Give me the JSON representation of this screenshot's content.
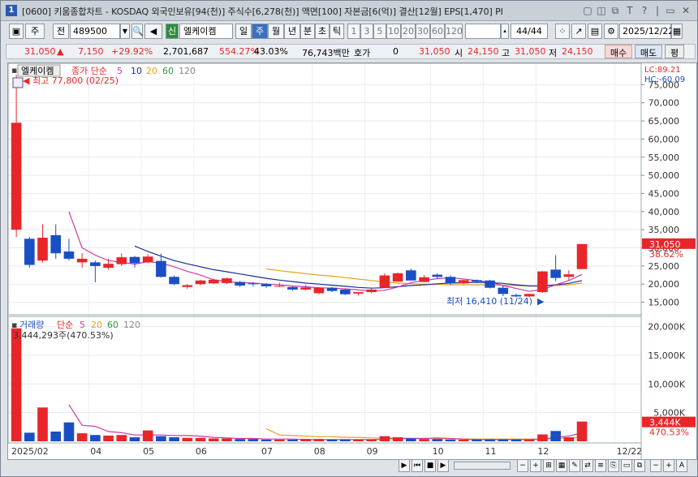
{
  "titlebar": {
    "num": "1",
    "text": "[0600] 키움종합차트 - KOSDAQ 외국인보유[94(천)] 주식수[6,278(천)] 액면[100] 자본금[6(억)] 결산[12월] EPS[1,470] PI",
    "controls": [
      "▢",
      "◫",
      "⧉",
      "T",
      "?",
      "|",
      "▭",
      "✕"
    ]
  },
  "toolbar": {
    "market": "주",
    "code_label": "전",
    "code": "489500",
    "name_badge": "신",
    "name": "엘케이켐",
    "periods": [
      "일",
      "주",
      "월",
      "년",
      "분",
      "초",
      "틱"
    ],
    "active_period": "주",
    "numbers": [
      "1",
      "3",
      "5",
      "10",
      "20",
      "30",
      "60",
      "120"
    ],
    "count": "44/44",
    "date": "2025/12/22"
  },
  "quote": {
    "price": "31,050",
    "arrow": "▲",
    "change": "7,150",
    "rate": "+29.92%",
    "volume": "2,701,687",
    "vol_rate": "554.27%",
    "turnover": "43.03%",
    "amount": "76,743백만",
    "hoga_label": "호가",
    "hoga": "0",
    "cur": "31,050",
    "open_l": "시",
    "open": "24,150",
    "high_l": "고",
    "high": "31,050",
    "low_l": "저",
    "low": "24,150",
    "buy": "매수",
    "sell": "매도",
    "avg": "평"
  },
  "legend": {
    "name": "엘케이켐",
    "close_ma": "종가 단순",
    "ma5": "5",
    "ma10": "10",
    "ma20": "20",
    "ma60": "60",
    "ma120": "120",
    "max_note": "최고 77,800 (02/25)",
    "min_note": "최저 16,410 (11/24)",
    "lc": "LC:89.21",
    "hc": "HC:-60.09",
    "price_tag": "31,050",
    "pct_tag": "38.62%"
  },
  "vol_legend": {
    "title": "거래량",
    "ma": "단순",
    "ma5": "5",
    "ma20": "20",
    "ma60": "60",
    "ma120": "120",
    "max_note": "3,444,293주(470.53%)",
    "tag": "3,444K",
    "pct": "470.53%"
  },
  "colors": {
    "up": "#e8262a",
    "down": "#1a4fc4",
    "ma5": "#cc3aa8",
    "ma10": "#1a2f8f",
    "ma20": "#e8a21a"
  },
  "chart_data": {
    "type": "candlestick",
    "y_ticks": [
      "75,000",
      "70,000",
      "65,000",
      "60,000",
      "55,000",
      "50,000",
      "45,000",
      "40,000",
      "35,000",
      "30,000",
      "25,000",
      "20,000",
      "15,000"
    ],
    "y_tick_values": [
      75000,
      70000,
      65000,
      60000,
      55000,
      50000,
      45000,
      40000,
      35000,
      30000,
      25000,
      20000,
      15000
    ],
    "ylim": [
      12000,
      80000
    ],
    "vol_ticks": [
      "20,000K",
      "15,000K",
      "10,000K",
      "5,000K"
    ],
    "vol_tick_values": [
      20000,
      15000,
      10000,
      5000
    ],
    "vol_lim": [
      0,
      21500
    ],
    "x_labels": [
      {
        "i": 0,
        "t": "2025/02"
      },
      {
        "i": 6,
        "t": "04"
      },
      {
        "i": 10,
        "t": "05"
      },
      {
        "i": 14,
        "t": "06"
      },
      {
        "i": 19,
        "t": "07"
      },
      {
        "i": 23,
        "t": "08"
      },
      {
        "i": 27,
        "t": "09"
      },
      {
        "i": 32,
        "t": "10"
      },
      {
        "i": 36,
        "t": "11"
      },
      {
        "i": 40,
        "t": "12"
      },
      {
        "i": 46,
        "t": "12/22"
      }
    ],
    "candles": [
      {
        "o": 35000,
        "h": 77800,
        "l": 33000,
        "c": 64500,
        "v": 19700
      },
      {
        "o": 32500,
        "h": 33000,
        "l": 24500,
        "c": 25300,
        "v": 1500
      },
      {
        "o": 26500,
        "h": 36500,
        "l": 26000,
        "c": 32800,
        "v": 5900
      },
      {
        "o": 33500,
        "h": 36500,
        "l": 27000,
        "c": 28500,
        "v": 1700
      },
      {
        "o": 29000,
        "h": 32500,
        "l": 26500,
        "c": 27000,
        "v": 3300
      },
      {
        "o": 26000,
        "h": 28500,
        "l": 24500,
        "c": 27000,
        "v": 1400
      },
      {
        "o": 26000,
        "h": 26500,
        "l": 20500,
        "c": 25000,
        "v": 1100
      },
      {
        "o": 24500,
        "h": 27000,
        "l": 24000,
        "c": 25600,
        "v": 1000
      },
      {
        "o": 25500,
        "h": 28500,
        "l": 25000,
        "c": 27400,
        "v": 1100
      },
      {
        "o": 27500,
        "h": 27800,
        "l": 24600,
        "c": 25800,
        "v": 700
      },
      {
        "o": 26000,
        "h": 28300,
        "l": 25800,
        "c": 27600,
        "v": 1900
      },
      {
        "o": 26400,
        "h": 28400,
        "l": 21800,
        "c": 22000,
        "v": 900
      },
      {
        "o": 22000,
        "h": 22400,
        "l": 19700,
        "c": 20000,
        "v": 700
      },
      {
        "o": 19200,
        "h": 20000,
        "l": 18700,
        "c": 19700,
        "v": 600
      },
      {
        "o": 20000,
        "h": 21200,
        "l": 19700,
        "c": 21000,
        "v": 600
      },
      {
        "o": 20200,
        "h": 21500,
        "l": 20100,
        "c": 21200,
        "v": 500
      },
      {
        "o": 20300,
        "h": 21800,
        "l": 20000,
        "c": 21600,
        "v": 500
      },
      {
        "o": 20600,
        "h": 20900,
        "l": 19200,
        "c": 19600,
        "v": 400
      },
      {
        "o": 20200,
        "h": 20500,
        "l": 19300,
        "c": 20000,
        "v": 400
      },
      {
        "o": 20000,
        "h": 20300,
        "l": 19000,
        "c": 19400,
        "v": 300
      },
      {
        "o": 19300,
        "h": 20400,
        "l": 19200,
        "c": 19500,
        "v": 300
      },
      {
        "o": 19200,
        "h": 19400,
        "l": 18200,
        "c": 18500,
        "v": 300
      },
      {
        "o": 18500,
        "h": 19800,
        "l": 18300,
        "c": 19100,
        "v": 400
      },
      {
        "o": 17500,
        "h": 19200,
        "l": 17200,
        "c": 19000,
        "v": 400
      },
      {
        "o": 19000,
        "h": 19200,
        "l": 17800,
        "c": 18100,
        "v": 300
      },
      {
        "o": 18500,
        "h": 18700,
        "l": 17000,
        "c": 17200,
        "v": 300
      },
      {
        "o": 17400,
        "h": 17800,
        "l": 16900,
        "c": 17800,
        "v": 300
      },
      {
        "o": 17800,
        "h": 19000,
        "l": 17500,
        "c": 18500,
        "v": 300
      },
      {
        "o": 19000,
        "h": 23000,
        "l": 19000,
        "c": 22400,
        "v": 900
      },
      {
        "o": 20700,
        "h": 23200,
        "l": 20600,
        "c": 23000,
        "v": 700
      },
      {
        "o": 23800,
        "h": 24300,
        "l": 21000,
        "c": 21000,
        "v": 500
      },
      {
        "o": 20600,
        "h": 22500,
        "l": 20500,
        "c": 21900,
        "v": 400
      },
      {
        "o": 22600,
        "h": 23000,
        "l": 21500,
        "c": 22000,
        "v": 400
      },
      {
        "o": 22000,
        "h": 22400,
        "l": 19800,
        "c": 20200,
        "v": 300
      },
      {
        "o": 20200,
        "h": 21200,
        "l": 20000,
        "c": 21100,
        "v": 300
      },
      {
        "o": 21100,
        "h": 21300,
        "l": 20300,
        "c": 20700,
        "v": 300
      },
      {
        "o": 21000,
        "h": 21200,
        "l": 18800,
        "c": 19000,
        "v": 300
      },
      {
        "o": 19000,
        "h": 19600,
        "l": 16700,
        "c": 17300,
        "v": 300
      },
      {
        "o": 17000,
        "h": 17400,
        "l": 16410,
        "c": 16600,
        "v": 300
      },
      {
        "o": 16600,
        "h": 17400,
        "l": 16400,
        "c": 17300,
        "v": 300
      },
      {
        "o": 17800,
        "h": 23600,
        "l": 17600,
        "c": 23500,
        "v": 1200
      },
      {
        "o": 24000,
        "h": 28000,
        "l": 20800,
        "c": 21700,
        "v": 1800
      },
      {
        "o": 22000,
        "h": 23800,
        "l": 21000,
        "c": 22700,
        "v": 700
      },
      {
        "o": 24150,
        "h": 31050,
        "l": 24150,
        "c": 31050,
        "v": 3444
      }
    ],
    "ma5": [
      null,
      null,
      null,
      null,
      40000,
      30000,
      28000,
      26500,
      26000,
      25500,
      26200,
      25800,
      24800,
      23500,
      22500,
      21200,
      20700,
      20400,
      20300,
      20000,
      19800,
      19500,
      19300,
      19000,
      18900,
      18700,
      18400,
      18100,
      18300,
      19200,
      20400,
      21000,
      21500,
      21800,
      21400,
      21000,
      20500,
      19600,
      18800,
      18000,
      18500,
      19800,
      21000,
      22700
    ],
    "ma10": [
      null,
      null,
      null,
      null,
      null,
      null,
      null,
      null,
      null,
      30500,
      29000,
      27700,
      26500,
      25600,
      24800,
      24000,
      23400,
      22800,
      22200,
      21600,
      21100,
      20700,
      20300,
      20000,
      19700,
      19400,
      19100,
      18900,
      19000,
      19300,
      19600,
      19800,
      20100,
      20300,
      20400,
      20500,
      20400,
      20200,
      19800,
      19500,
      19500,
      19800,
      20200,
      21000
    ],
    "ma20": [
      null,
      null,
      null,
      null,
      null,
      null,
      null,
      null,
      null,
      null,
      null,
      null,
      null,
      null,
      null,
      null,
      null,
      null,
      null,
      24200,
      23700,
      23300,
      22900,
      22500,
      22200,
      21800,
      21400,
      21000,
      20600,
      20300,
      20100,
      20000,
      19900,
      19800,
      19800,
      19800,
      19800,
      19700,
      19600,
      19500,
      19500,
      19600,
      19800,
      20300
    ],
    "vol_ma5": [
      null,
      null,
      null,
      null,
      6400,
      2800,
      2600,
      1700,
      1500,
      1100,
      1100,
      1100,
      1000,
      1000,
      900,
      700,
      600,
      500,
      500,
      400,
      400,
      400,
      300,
      300,
      300,
      300,
      300,
      300,
      400,
      500,
      500,
      500,
      600,
      500,
      400,
      300,
      300,
      300,
      300,
      300,
      400,
      700,
      900,
      1500
    ],
    "vol_ma20": [
      null,
      null,
      null,
      null,
      null,
      null,
      null,
      null,
      null,
      null,
      null,
      null,
      null,
      null,
      null,
      null,
      null,
      null,
      null,
      2200,
      1100,
      1000,
      900,
      800,
      800,
      700,
      700,
      600,
      600,
      600,
      500,
      500,
      500,
      400,
      400,
      400,
      400,
      400,
      400,
      400,
      400,
      500,
      600,
      700
    ]
  }
}
